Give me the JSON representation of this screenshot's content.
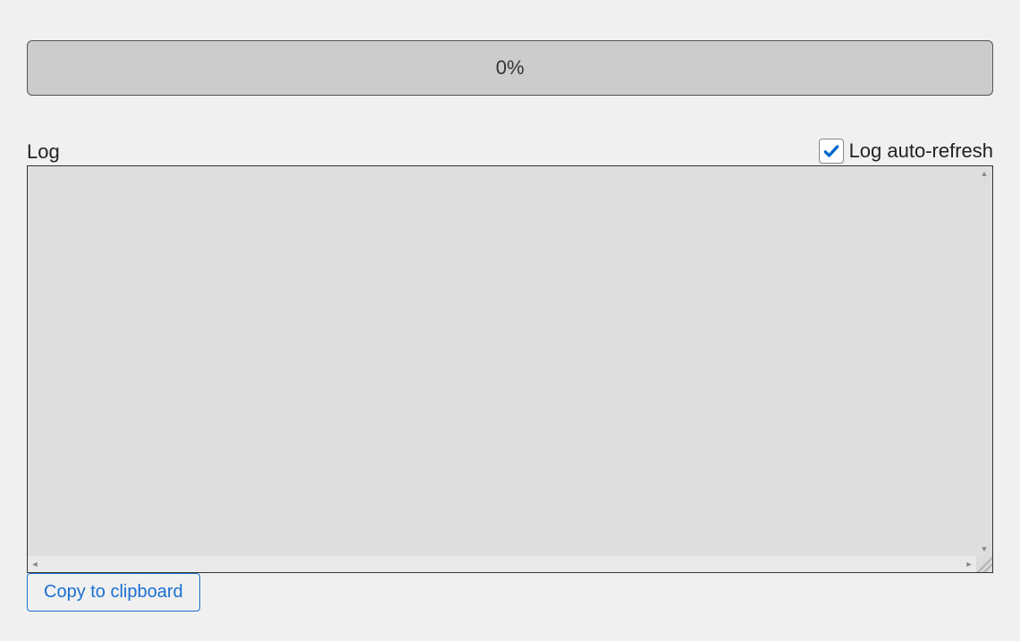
{
  "progress": {
    "percent_label": "0%"
  },
  "log": {
    "title": "Log",
    "auto_refresh_label": "Log auto-refresh",
    "auto_refresh_checked": true,
    "content": ""
  },
  "actions": {
    "copy_label": "Copy to clipboard"
  }
}
